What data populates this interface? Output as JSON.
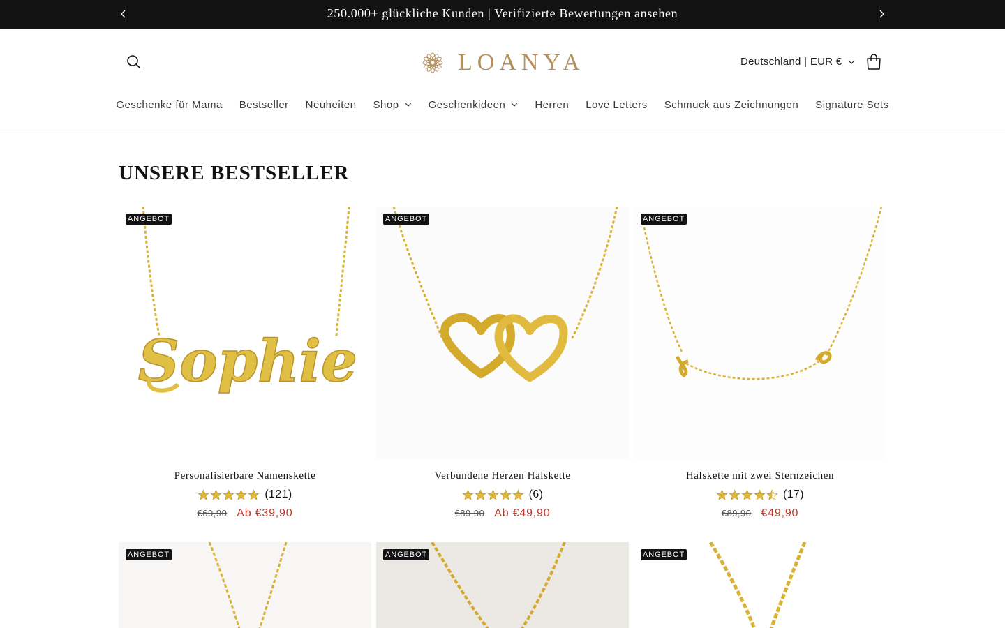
{
  "announcement": {
    "text": "250.000+ glückliche Kunden | Verifizierte Bewertungen ansehen",
    "prev_icon": "chevron-left-icon",
    "next_icon": "chevron-right-icon"
  },
  "header": {
    "logo_text": "LOANYA",
    "logo_color": "#b3905e",
    "locale": "Deutschland | EUR €",
    "search_icon": "search-icon",
    "cart_icon": "cart-icon"
  },
  "nav": {
    "items": [
      {
        "label": "Geschenke für Mama",
        "dropdown": false
      },
      {
        "label": "Bestseller",
        "dropdown": false
      },
      {
        "label": "Neuheiten",
        "dropdown": false
      },
      {
        "label": "Shop",
        "dropdown": true
      },
      {
        "label": "Geschenkideen",
        "dropdown": true
      },
      {
        "label": "Herren",
        "dropdown": false
      },
      {
        "label": "Love Letters",
        "dropdown": false
      },
      {
        "label": "Schmuck aus Zeichnungen",
        "dropdown": false
      },
      {
        "label": "Signature Sets",
        "dropdown": false
      }
    ]
  },
  "section": {
    "title": "UNSERE BESTSELLER"
  },
  "products": [
    {
      "badge": "ANGEBOT",
      "name": "Personalisierbare Namenskette",
      "rating": 5,
      "reviews": "(121)",
      "old_price": "€69,90",
      "new_price": "Ab €39,90",
      "image": "name-necklace-sophie"
    },
    {
      "badge": "ANGEBOT",
      "name": "Verbundene Herzen Halskette",
      "rating": 5,
      "reviews": "(6)",
      "old_price": "€89,90",
      "new_price": "Ab €49,90",
      "image": "linked-hearts-necklace"
    },
    {
      "badge": "ANGEBOT",
      "name": "Halskette mit zwei Sternzeichen",
      "rating": 4.5,
      "reviews": "(17)",
      "old_price": "€89,90",
      "new_price": "€49,90",
      "image": "zodiac-necklace"
    }
  ],
  "products_row2": [
    {
      "badge": "ANGEBOT"
    },
    {
      "badge": "ANGEBOT"
    },
    {
      "badge": "ANGEBOT"
    }
  ],
  "colors": {
    "sale_price": "#c0392b",
    "star": "#e0b83a",
    "gold": "#d9b233"
  }
}
